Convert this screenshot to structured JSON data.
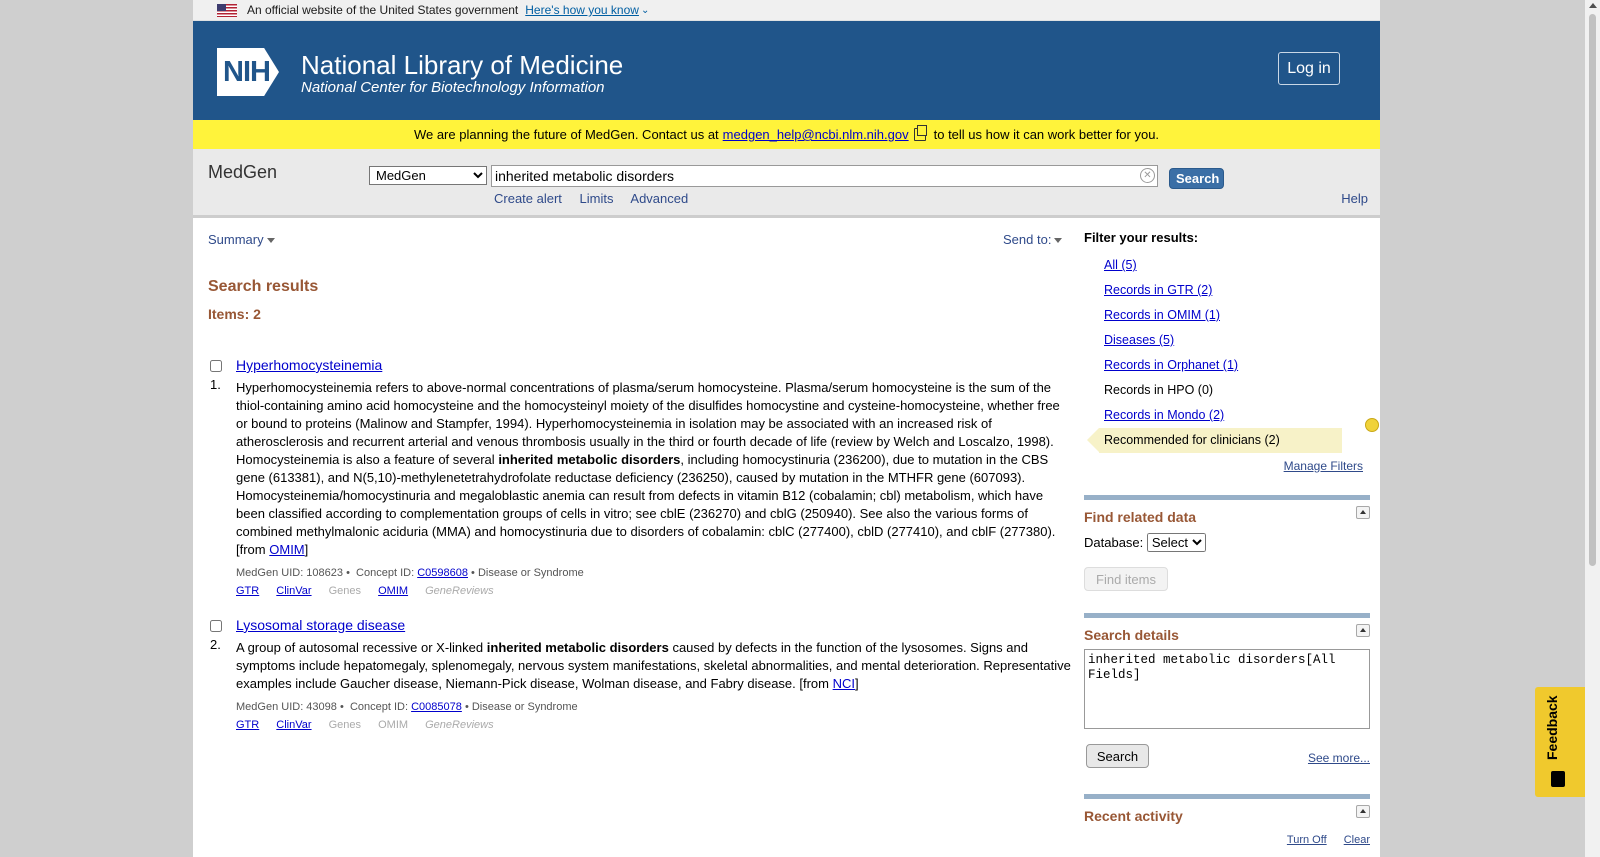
{
  "banner": {
    "text": "An official website of the United States government",
    "link": "Here's how you know"
  },
  "header": {
    "logo": "NIH",
    "title": "National Library of Medicine",
    "subtitle": "National Center for Biotechnology Information",
    "login": "Log in"
  },
  "notice": {
    "before": "We are planning the future of MedGen. Contact us at",
    "email": "medgen_help@ncbi.nlm.nih.gov",
    "after": "to tell us how it can work better for you."
  },
  "search": {
    "app_label": "MedGen",
    "db_selected": "MedGen",
    "term": "inherited metabolic disorders",
    "button": "Search",
    "links": [
      "Create alert",
      "Limits",
      "Advanced"
    ],
    "help": "Help"
  },
  "toolbar": {
    "summary": "Summary",
    "send_to": "Send to:"
  },
  "results": {
    "title": "Search results",
    "items": "Items: 2",
    "list": [
      {
        "num": "1.",
        "title": "Hyperhomocysteinemia",
        "desc_a": "Hyperhomocysteinemia refers to above-normal concentrations of plasma/serum homocysteine. Plasma/serum homocysteine is the sum of the thiol-containing amino acid homocysteine and the homocysteinyl moiety of the disulfides homocystine and cysteine-homocysteine, whether free or bound to proteins (Malinow and Stampfer, 1994). Hyperhomocysteinemia in isolation may be associated with an increased risk of atherosclerosis and recurrent arterial and venous thrombosis usually in the third or fourth decade of life (review by Welch and Loscalzo, 1998). Homocysteinemia is also a feature of several",
        "desc_bold": "inherited metabolic disorders",
        "desc_b": ", including homocystinuria (236200), due to mutation in the CBS gene (613381), and N(5,10)-methylenetetrahydrofolate reductase deficiency (236250), caused by mutation in the MTHFR gene (607093). Homocysteinemia/homocystinuria and megaloblastic anemia can result from defects in vitamin B12 (cobalamin; cbl) metabolism, which have been classified according to complementation groups of cells in vitro; see cblE (236270) and cblG (250940). See also the various forms of combined methylmalonic aciduria (MMA) and homocystinuria due to disorders of cobalamin: cblC (277400), cblD (277410), and cblF (277380). [from",
        "source": "OMIM",
        "close": "]",
        "uid": "MedGen UID: 108623 •",
        "concept_label": "Concept ID:",
        "concept": "C0598608",
        "type": "• Disease or Syndrome",
        "links": [
          "GTR",
          "ClinVar",
          "Genes",
          "OMIM",
          "GeneReviews"
        ]
      },
      {
        "num": "2.",
        "title": "Lysosomal storage disease",
        "desc_a": "A group of autosomal recessive or X-linked",
        "desc_bold": "inherited metabolic disorders",
        "desc_b": "caused by defects in the function of the lysosomes. Signs and symptoms include hepatomegaly, splenomegaly, nervous system manifestations, skeletal abnormalities, and mental deterioration. Representative examples include Gaucher disease, Niemann-Pick disease, Wolman disease, and Fabry disease. [from",
        "source": "NCI",
        "close": "]",
        "uid": "MedGen UID: 43098 •",
        "concept_label": "Concept ID:",
        "concept": "C0085078",
        "type": "• Disease or Syndrome",
        "links": [
          "GTR",
          "ClinVar",
          "Genes",
          "OMIM",
          "GeneReviews"
        ]
      }
    ]
  },
  "sidebar": {
    "filter_title": "Filter your results:",
    "filters": [
      "All (5)",
      "Records in GTR (2)",
      "Records in OMIM (1)",
      "Diseases (5)",
      "Records in Orphanet (1)",
      "Records in HPO (0)",
      "Records in Mondo (2)",
      "Recommended for clinicians (2)"
    ],
    "manage": "Manage Filters",
    "related_title": "Find related data",
    "database_label": "Database:",
    "database_selected": "Select",
    "find_items": "Find items",
    "details_title": "Search details",
    "details_query": "inherited metabolic disorders[All Fields]",
    "details_search": "Search",
    "see_more": "See more...",
    "recent_title": "Recent activity",
    "turn_off": "Turn Off",
    "clear": "Clear"
  },
  "feedback": "Feedback"
}
